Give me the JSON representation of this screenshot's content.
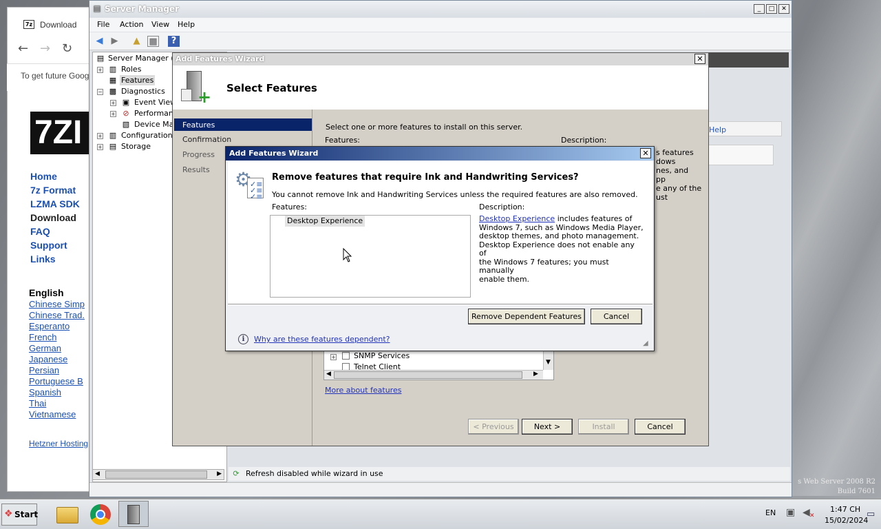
{
  "browser": {
    "tab_title": "Download",
    "favicon": "7z",
    "info_bar_text": "To get future Goog",
    "page": {
      "logo": "7ZI",
      "nav": [
        "Home",
        "7z Format",
        "LZMA SDK",
        "Download",
        "FAQ",
        "Support",
        "Links"
      ],
      "current_nav": "Download",
      "language_heading": "English",
      "languages": [
        "Chinese Simp",
        "Chinese Trad.",
        "Esperanto",
        "French",
        "German",
        "Japanese",
        "Persian",
        "Portuguese B",
        "Spanish",
        "Thai",
        "Vietnamese"
      ],
      "footer_link": "Hetzner Hosting"
    }
  },
  "server_manager": {
    "title": "Server Manager",
    "menu": [
      "File",
      "Action",
      "View",
      "Help"
    ],
    "tree": {
      "root": "Server Manager (W",
      "roles": "Roles",
      "features": "Features",
      "diagnostics": "Diagnostics",
      "event_viewer": "Event Viewe",
      "performance": "Performanc",
      "device_manager": "Device Man",
      "configuration": "Configuration",
      "storage": "Storage"
    },
    "help_link": "Help",
    "status": "Refresh disabled while wizard in use",
    "bg_description_lines": [
      "s features",
      "dows",
      "nes, and",
      "pp",
      "e any of the",
      "ust"
    ]
  },
  "wizard": {
    "title": "Add Features Wizard",
    "heading": "Select Features",
    "steps": [
      "Features",
      "Confirmation",
      "Progress",
      "Results"
    ],
    "instruction": "Select one or more features to install on this server.",
    "features_label": "Features:",
    "description_label": "Description:",
    "list_items": [
      "SNMP Services",
      "Telnet Client"
    ],
    "more_link": "More about features",
    "buttons": {
      "previous": "< Previous",
      "next": "Next >",
      "install": "Install",
      "cancel": "Cancel"
    }
  },
  "dialog": {
    "title": "Add Features Wizard",
    "heading": "Remove features that require Ink and Handwriting Services?",
    "message": "You cannot remove Ink and Handwriting Services unless the required features are also removed.",
    "features_label": "Features:",
    "feature_items": [
      "Desktop Experience"
    ],
    "description_label": "Description:",
    "description_link": "Desktop Experience",
    "description_lines": [
      " includes features of",
      "Windows 7, such as Windows Media Player,",
      "desktop themes, and photo management.",
      "Desktop Experience does not enable any of",
      "the Windows 7 features; you must manually",
      "enable them."
    ],
    "remove_button": "Remove Dependent Features",
    "cancel_button": "Cancel",
    "help_link": "Why are these features dependent?"
  },
  "desktop": {
    "brand_line1": "s Web Server 2008 R2",
    "brand_line2": "Build 7601"
  },
  "taskbar": {
    "start_label": "Start",
    "language": "EN",
    "time": "1:47 CH",
    "date": "15/02/2024"
  }
}
